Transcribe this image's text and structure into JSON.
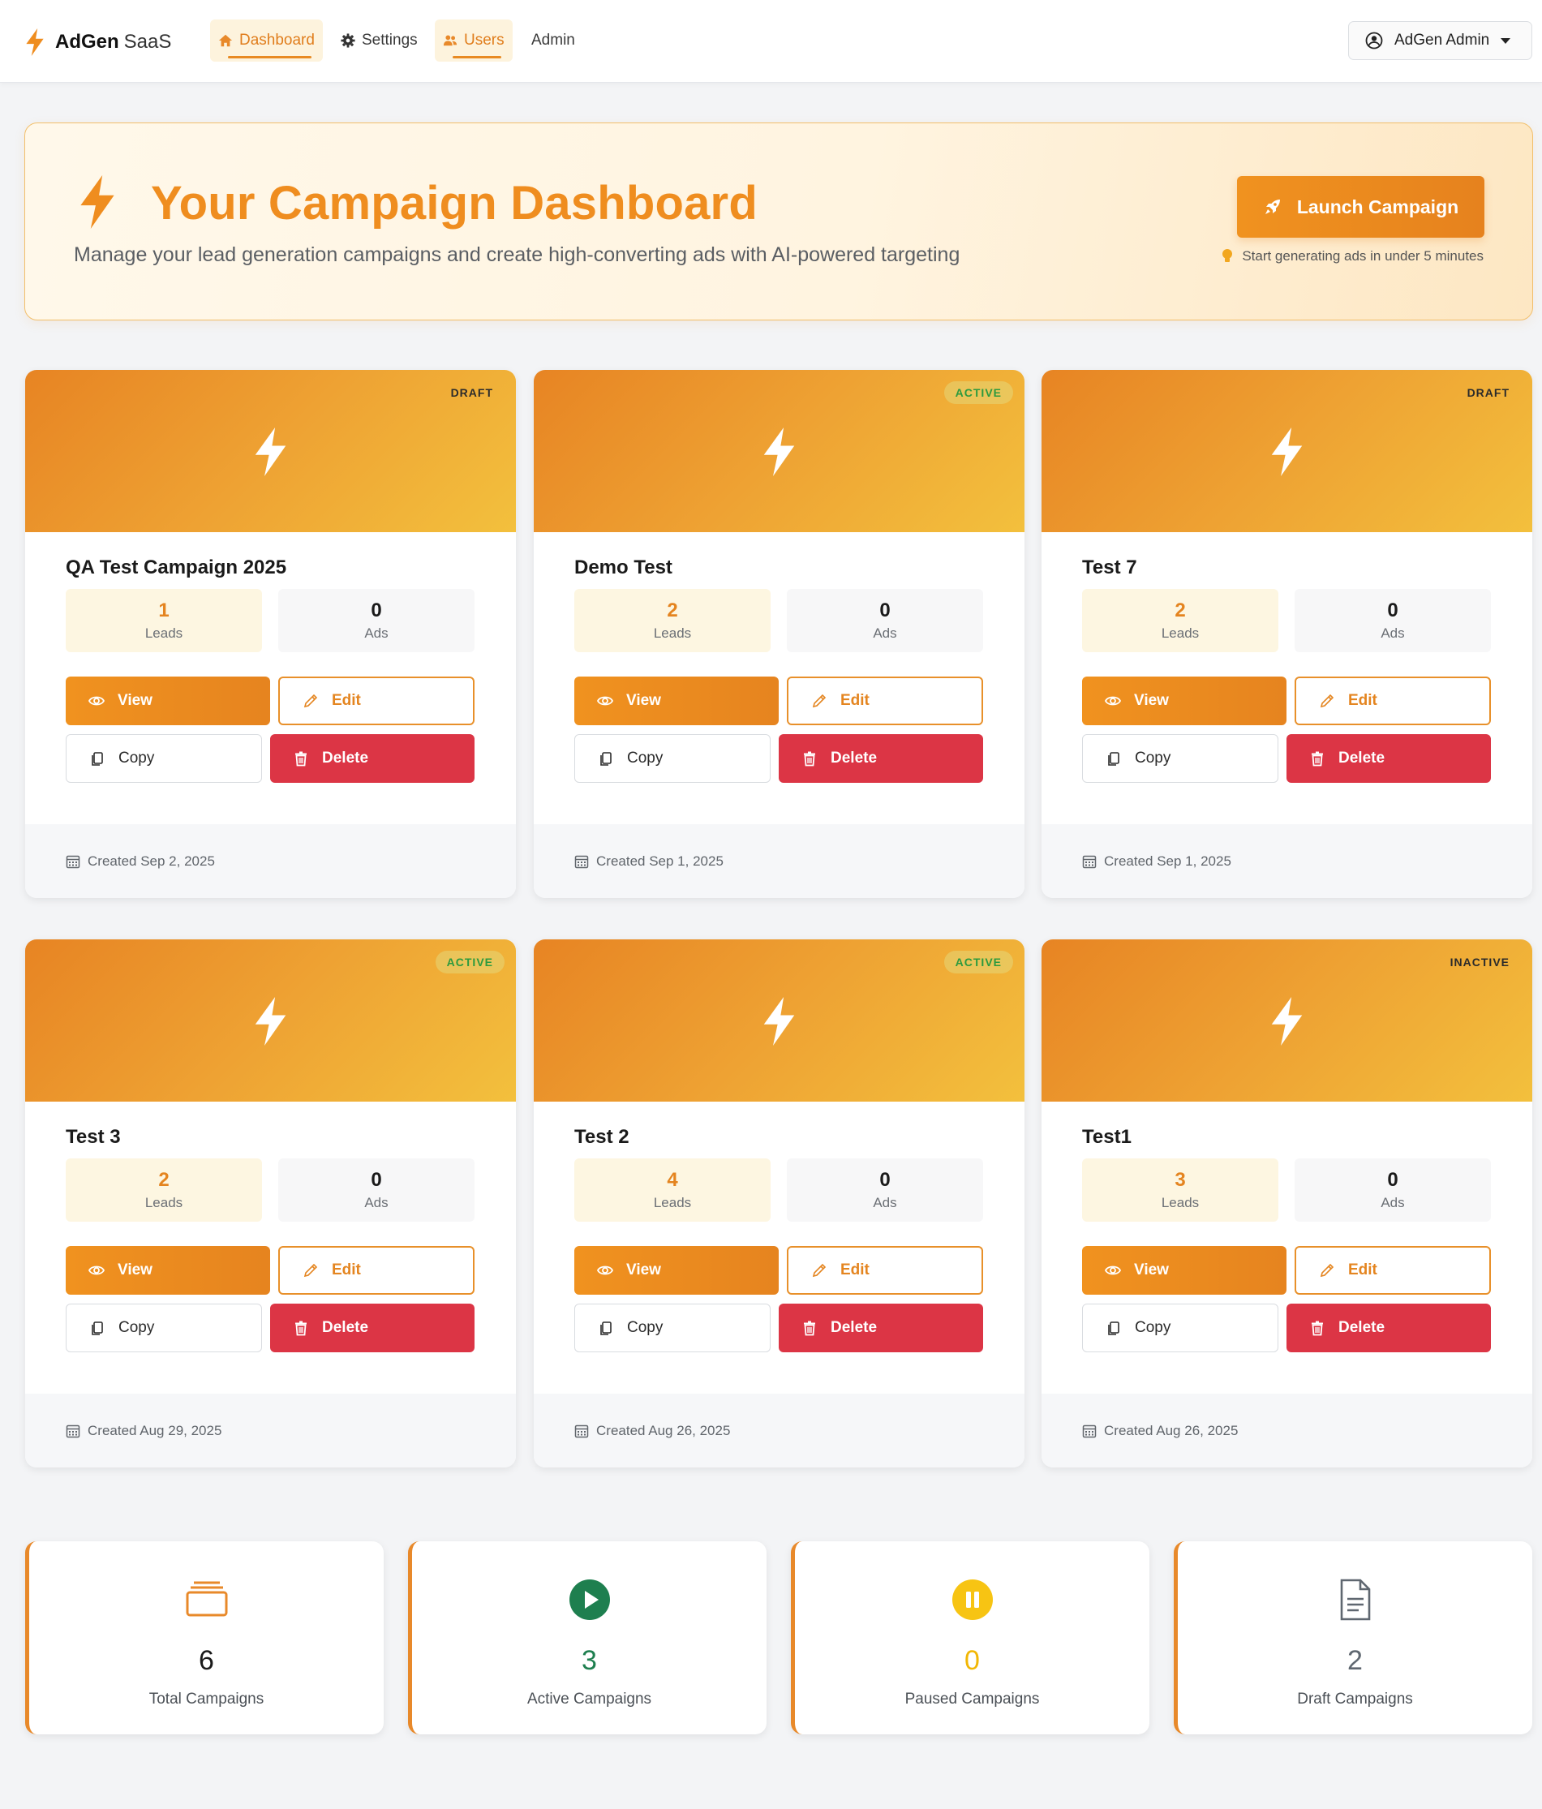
{
  "brand": {
    "name_bold": "AdGen",
    "name_light": "SaaS"
  },
  "nav": {
    "dashboard": "Dashboard",
    "settings": "Settings",
    "users": "Users",
    "admin": "Admin"
  },
  "user_menu": {
    "label": "AdGen Admin"
  },
  "hero": {
    "title": "Your Campaign Dashboard",
    "subtitle": "Manage your lead generation campaigns and create high-converting ads with AI-powered targeting",
    "launch_label": "Launch Campaign",
    "tip": "Start generating ads in under 5 minutes"
  },
  "labels": {
    "leads": "Leads",
    "ads": "Ads",
    "view": "View",
    "edit": "Edit",
    "copy": "Copy",
    "delete": "Delete"
  },
  "campaigns": [
    {
      "title": "QA Test Campaign 2025",
      "status": "DRAFT",
      "leads": "1",
      "ads": "0",
      "created": "Created Sep 2, 2025"
    },
    {
      "title": "Demo Test",
      "status": "ACTIVE",
      "leads": "2",
      "ads": "0",
      "created": "Created Sep 1, 2025"
    },
    {
      "title": "Test 7",
      "status": "DRAFT",
      "leads": "2",
      "ads": "0",
      "created": "Created Sep 1, 2025"
    },
    {
      "title": "Test 3",
      "status": "ACTIVE",
      "leads": "2",
      "ads": "0",
      "created": "Created Aug 29, 2025"
    },
    {
      "title": "Test 2",
      "status": "ACTIVE",
      "leads": "4",
      "ads": "0",
      "created": "Created Aug 26, 2025"
    },
    {
      "title": "Test1",
      "status": "INACTIVE",
      "leads": "3",
      "ads": "0",
      "created": "Created Aug 26, 2025"
    }
  ],
  "summary": [
    {
      "value": "6",
      "label": "Total Campaigns",
      "icon": "stack-icon",
      "color": "#1a1a1a"
    },
    {
      "value": "3",
      "label": "Active Campaigns",
      "icon": "play-circle-icon",
      "color": "#1e7f4f"
    },
    {
      "value": "0",
      "label": "Paused Campaigns",
      "icon": "pause-circle-icon",
      "color": "#f2b705"
    },
    {
      "value": "2",
      "label": "Draft Campaigns",
      "icon": "document-icon",
      "color": "#5f6770"
    }
  ],
  "colors": {
    "accent": "#e8892a",
    "accent_light": "#fdf6e1",
    "danger": "#dc3545",
    "success": "#1e7f4f",
    "warning": "#f2b705"
  }
}
